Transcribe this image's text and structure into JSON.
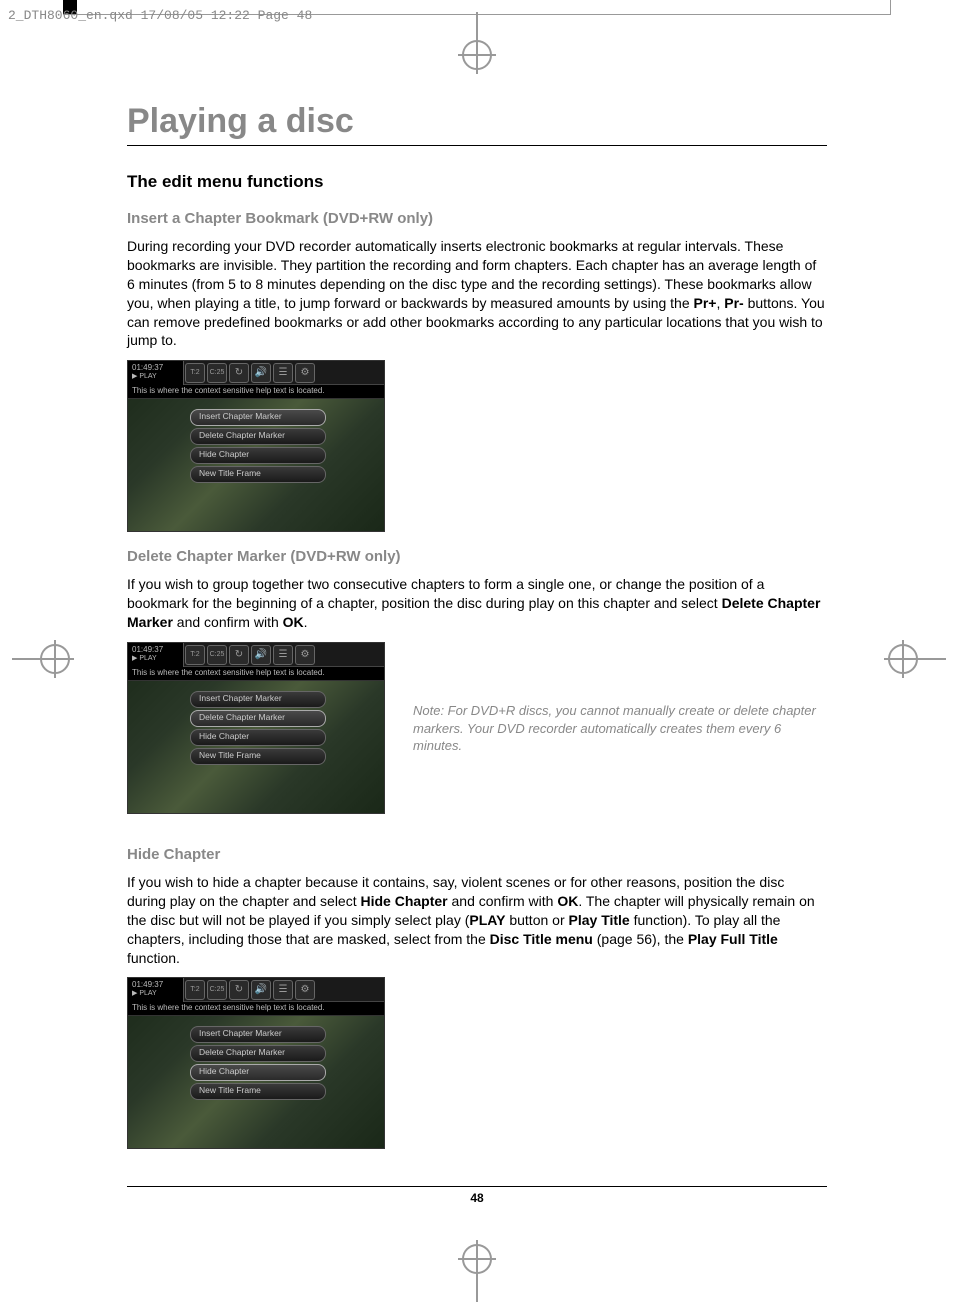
{
  "header_line": "2_DTH8060_en.qxd  17/08/05  12:22  Page 48",
  "title": "Playing a disc",
  "section_heading": "The edit menu functions",
  "sections": [
    {
      "heading": "Insert a Chapter Bookmark (DVD+RW only)",
      "para_parts": [
        {
          "t": "During recording your DVD recorder automatically inserts electronic bookmarks at regular intervals. These bookmarks are invisible. They partition the recording and form chapters. Each chapter has an average length of 6 minutes (from 5 to 8 minutes depending on the disc type and the recording settings). These bookmarks allow you, when playing a title, to jump forward or backwards by measured amounts by using the "
        },
        {
          "t": "Pr+",
          "b": true
        },
        {
          "t": ", "
        },
        {
          "t": "Pr-",
          "b": true
        },
        {
          "t": " buttons. You can remove predefined bookmarks or add other bookmarks according to any particular locations that you wish to jump to."
        }
      ]
    },
    {
      "heading": "Delete Chapter Marker (DVD+RW only)",
      "para_parts": [
        {
          "t": "If you wish to group together two consecutive chapters to form a single one, or change the position of a bookmark for the beginning of a chapter, position the disc during play on this chapter and select "
        },
        {
          "t": "Delete Chapter Marker",
          "b": true
        },
        {
          "t": " and confirm with "
        },
        {
          "t": "OK",
          "b": true
        },
        {
          "t": "."
        }
      ],
      "note": "Note: For DVD+R discs, you cannot manually create or delete chapter markers. Your DVD recorder automatically creates them every 6 minutes."
    },
    {
      "heading": "Hide Chapter",
      "para_parts": [
        {
          "t": "If you wish to hide a chapter because it contains, say, violent scenes or for other reasons, position the disc during play on the chapter and select "
        },
        {
          "t": "Hide Chapter",
          "b": true
        },
        {
          "t": " and confirm with "
        },
        {
          "t": "OK",
          "b": true
        },
        {
          "t": ". The chapter will physically remain on the disc but will not be played if you simply select play ("
        },
        {
          "t": "PLAY",
          "b": true
        },
        {
          "t": " button or "
        },
        {
          "t": "Play Title",
          "b": true
        },
        {
          "t": " function). To play all the chapters, including those that are masked, select from the "
        },
        {
          "t": "Disc Title menu",
          "b": true
        },
        {
          "t": " (page 56), the "
        },
        {
          "t": "Play Full Title",
          "b": true
        },
        {
          "t": " function."
        }
      ]
    }
  ],
  "screenshot": {
    "time": "01:49:37",
    "play_label": "▶ PLAY",
    "t_label": "T:2",
    "c_label": "C:25",
    "help_text": "This is where the context sensitive help text is located.",
    "menu_items": [
      "Insert Chapter Marker",
      "Delete Chapter Marker",
      "Hide Chapter",
      "New Title Frame"
    ]
  },
  "highlights": [
    0,
    1,
    2
  ],
  "page_number": "48"
}
